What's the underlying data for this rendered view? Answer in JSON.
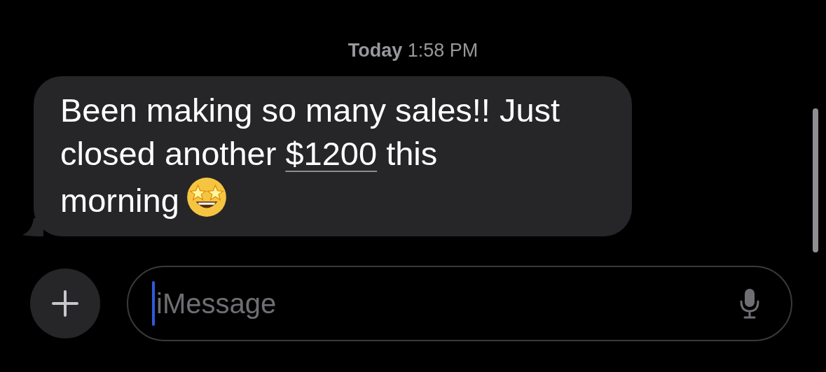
{
  "timestamp": {
    "day": "Today",
    "time": "1:58 PM"
  },
  "message": {
    "parts": [
      {
        "kind": "text",
        "text": "Been making so many sales!! Just closed another "
      },
      {
        "kind": "link",
        "text": "$1200"
      },
      {
        "kind": "text",
        "text": " this morning"
      }
    ],
    "emoji": true
  },
  "composer": {
    "placeholder": "iMessage"
  }
}
